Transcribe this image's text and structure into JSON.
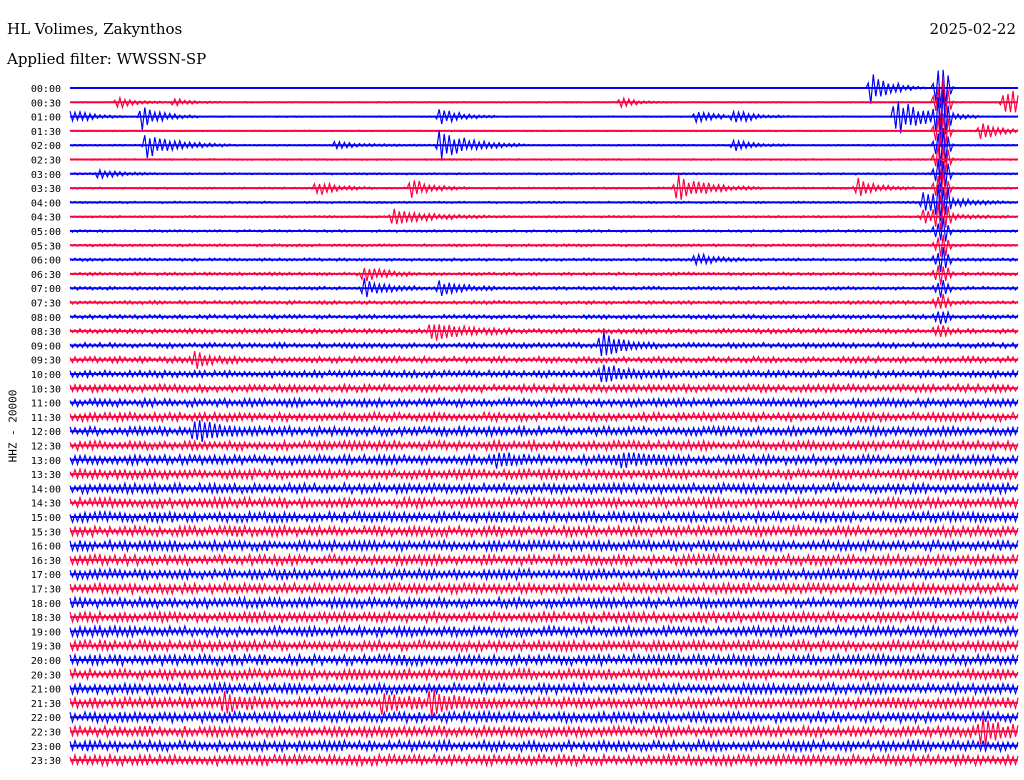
{
  "header": {
    "station": "HL Volimes, Zakynthos",
    "filter": "Applied filter: WWSSN-SP",
    "date": "2025-02-22"
  },
  "chart_data": {
    "type": "line",
    "title": "HL Volimes, Zakynthos",
    "subtitle": "Applied filter: WWSSN-SP",
    "date": "2025-02-22",
    "ylabel": "HHZ - 20000",
    "xlabel": "",
    "row_labels": [
      "00:00",
      "00:30",
      "01:00",
      "01:30",
      "02:00",
      "02:30",
      "03:00",
      "03:30",
      "04:00",
      "04:30",
      "05:00",
      "05:30",
      "06:00",
      "06:30",
      "07:00",
      "07:30",
      "08:00",
      "08:30",
      "09:00",
      "09:30",
      "10:00",
      "10:30",
      "11:00",
      "11:30",
      "12:00",
      "12:30",
      "13:00",
      "13:30",
      "14:00",
      "14:30",
      "15:00",
      "15:30",
      "16:00",
      "16:30",
      "17:00",
      "17:30",
      "18:00",
      "18:30",
      "19:00",
      "19:30",
      "20:00",
      "20:30",
      "21:00",
      "21:30",
      "22:00",
      "22:30",
      "23:00",
      "23:30"
    ],
    "trace_colors": [
      "#0000ff",
      "#ff0040"
    ],
    "noise_level": [
      0.3,
      0.4,
      0.5,
      0.5,
      0.6,
      0.6,
      0.7,
      0.7,
      0.8,
      0.8,
      0.9,
      1.0,
      1.1,
      1.2,
      1.3,
      1.4,
      1.6,
      1.8,
      2.0,
      2.3,
      2.6,
      2.9,
      3.1,
      3.3,
      3.4,
      3.5,
      3.6,
      3.6,
      3.7,
      3.7,
      3.8,
      3.8,
      3.8,
      3.8,
      3.8,
      3.8,
      3.8,
      3.8,
      3.8,
      3.9,
      3.9,
      3.9,
      3.9,
      3.9,
      3.9,
      3.9,
      3.9,
      3.9
    ],
    "events": [
      {
        "row": 0,
        "x": 0.845,
        "amp": 18,
        "dur": 0.02
      },
      {
        "row": 1,
        "x": 0.05,
        "amp": 6,
        "dur": 0.02
      },
      {
        "row": 1,
        "x": 0.11,
        "amp": 4,
        "dur": 0.02
      },
      {
        "row": 1,
        "x": 0.58,
        "amp": 5,
        "dur": 0.02
      },
      {
        "row": 1,
        "x": 0.985,
        "amp": 16,
        "dur": 0.04
      },
      {
        "row": 2,
        "x": 0.0,
        "amp": 8,
        "dur": 0.02
      },
      {
        "row": 2,
        "x": 0.075,
        "amp": 14,
        "dur": 0.02
      },
      {
        "row": 2,
        "x": 0.39,
        "amp": 10,
        "dur": 0.02
      },
      {
        "row": 2,
        "x": 0.66,
        "amp": 7,
        "dur": 0.02
      },
      {
        "row": 2,
        "x": 0.7,
        "amp": 8,
        "dur": 0.02
      },
      {
        "row": 2,
        "x": 0.87,
        "amp": 20,
        "dur": 0.03
      },
      {
        "row": 3,
        "x": 0.96,
        "amp": 10,
        "dur": 0.02
      },
      {
        "row": 4,
        "x": 0.08,
        "amp": 14,
        "dur": 0.03
      },
      {
        "row": 4,
        "x": 0.28,
        "amp": 4,
        "dur": 0.03
      },
      {
        "row": 4,
        "x": 0.39,
        "amp": 16,
        "dur": 0.03
      },
      {
        "row": 4,
        "x": 0.7,
        "amp": 6,
        "dur": 0.02
      },
      {
        "row": 6,
        "x": 0.03,
        "amp": 5,
        "dur": 0.02
      },
      {
        "row": 7,
        "x": 0.26,
        "amp": 8,
        "dur": 0.02
      },
      {
        "row": 7,
        "x": 0.36,
        "amp": 10,
        "dur": 0.02
      },
      {
        "row": 7,
        "x": 0.64,
        "amp": 14,
        "dur": 0.03
      },
      {
        "row": 7,
        "x": 0.83,
        "amp": 10,
        "dur": 0.02
      },
      {
        "row": 8,
        "x": 0.9,
        "amp": 12,
        "dur": 0.03
      },
      {
        "row": 9,
        "x": 0.34,
        "amp": 8,
        "dur": 0.04
      },
      {
        "row": 9,
        "x": 0.9,
        "amp": 7,
        "dur": 0.03
      },
      {
        "row": 12,
        "x": 0.66,
        "amp": 6,
        "dur": 0.02
      },
      {
        "row": 13,
        "x": 0.31,
        "amp": 8,
        "dur": 0.02
      },
      {
        "row": 14,
        "x": 0.31,
        "amp": 10,
        "dur": 0.02
      },
      {
        "row": 14,
        "x": 0.39,
        "amp": 8,
        "dur": 0.02
      },
      {
        "row": 17,
        "x": 0.38,
        "amp": 10,
        "dur": 0.03
      },
      {
        "row": 18,
        "x": 0.56,
        "amp": 14,
        "dur": 0.02
      },
      {
        "row": 19,
        "x": 0.13,
        "amp": 8,
        "dur": 0.02
      },
      {
        "row": 20,
        "x": 0.56,
        "amp": 8,
        "dur": 0.03
      },
      {
        "row": 24,
        "x": 0.13,
        "amp": 12,
        "dur": 0.02
      },
      {
        "row": 26,
        "x": 0.58,
        "amp": 8,
        "dur": 0.02
      },
      {
        "row": 26,
        "x": 0.45,
        "amp": 6,
        "dur": 0.02
      },
      {
        "row": 43,
        "x": 0.16,
        "amp": 10,
        "dur": 0.02
      },
      {
        "row": 43,
        "x": 0.33,
        "amp": 10,
        "dur": 0.02
      },
      {
        "row": 43,
        "x": 0.38,
        "amp": 12,
        "dur": 0.02
      },
      {
        "row": 45,
        "x": 0.96,
        "amp": 12,
        "dur": 0.02
      }
    ],
    "big_event": {
      "row_start": 0,
      "row_end": 17,
      "x": 0.92,
      "amp": 30
    },
    "grid": false,
    "legend": "none"
  }
}
